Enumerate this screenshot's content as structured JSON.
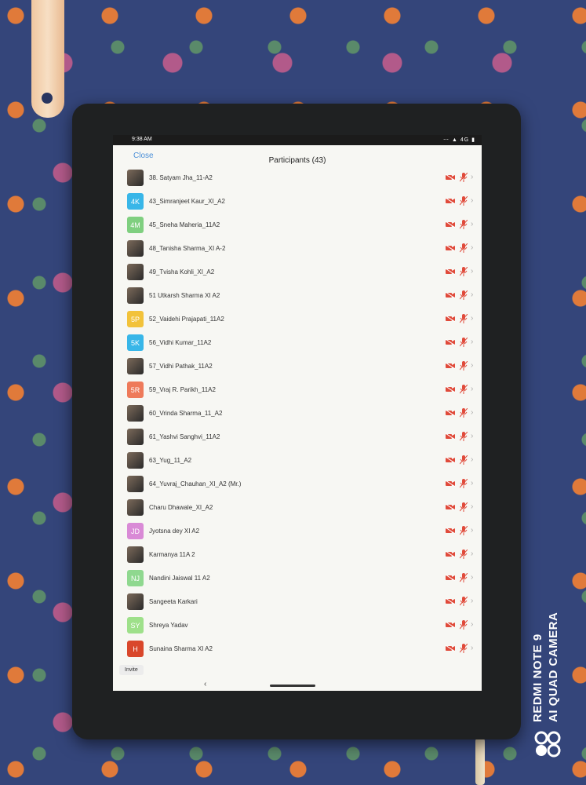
{
  "status": {
    "time": "9:38 AM",
    "icons": "⋯ ▲ 4G ▮"
  },
  "header": {
    "close_label": "Close",
    "title": "Participants (43)"
  },
  "participants": [
    {
      "name": "38. Satyam Jha_11-A2",
      "avatar": "",
      "color": ""
    },
    {
      "name": "43_Simranjeet Kaur_XI_A2",
      "avatar": "4K",
      "color": "#38b6e8"
    },
    {
      "name": "45_Sneha Maheria_11A2",
      "avatar": "4M",
      "color": "#7fcf7f"
    },
    {
      "name": "48_Tanisha Sharma_XI A-2",
      "avatar": "",
      "color": ""
    },
    {
      "name": "49_Tvisha Kohli_XI_A2",
      "avatar": "",
      "color": ""
    },
    {
      "name": "51 Utkarsh Sharma XI A2",
      "avatar": "",
      "color": ""
    },
    {
      "name": "52_Vaidehi Prajapati_11A2",
      "avatar": "5P",
      "color": "#f2c23a"
    },
    {
      "name": "56_Vidhi Kumar_11A2",
      "avatar": "5K",
      "color": "#38b6e8"
    },
    {
      "name": "57_Vidhi Pathak_11A2",
      "avatar": "",
      "color": ""
    },
    {
      "name": "59_Vraj R. Parikh_11A2",
      "avatar": "5R",
      "color": "#ee7a5a"
    },
    {
      "name": "60_Vrinda Sharma_11_A2",
      "avatar": "",
      "color": ""
    },
    {
      "name": "61_Yashvi Sanghvi_11A2",
      "avatar": "",
      "color": ""
    },
    {
      "name": "63_Yug_11_A2",
      "avatar": "",
      "color": ""
    },
    {
      "name": "64_Yuvraj_Chauhan_XI_A2 (Mr.)",
      "avatar": "",
      "color": ""
    },
    {
      "name": "Charu Dhawale_XI_A2",
      "avatar": "",
      "color": ""
    },
    {
      "name": "Jyotsna dey XI A2",
      "avatar": "JD",
      "color": "#d98ad6"
    },
    {
      "name": "Karmanya 11A 2",
      "avatar": "",
      "color": ""
    },
    {
      "name": "Nandini Jaiswal 11 A2",
      "avatar": "NJ",
      "color": "#8fd88f"
    },
    {
      "name": "Sangeeta Karkari",
      "avatar": "",
      "color": ""
    },
    {
      "name": "Shreya Yadav",
      "avatar": "SY",
      "color": "#9ee08a"
    },
    {
      "name": "Sunaina Sharma XI A2",
      "avatar": "H",
      "color": "#d9472b"
    }
  ],
  "footer": {
    "invite_label": "Invite"
  },
  "icons": {
    "camera": "camera-off-icon",
    "mic": "mic-muted-icon",
    "chevron": "chevron-right-icon"
  },
  "colors": {
    "accent": "#4a8fd8",
    "muted_red": "#e04a3a"
  },
  "watermark": {
    "line1": "REDMI NOTE 9",
    "line2": "AI QUAD CAMERA"
  }
}
